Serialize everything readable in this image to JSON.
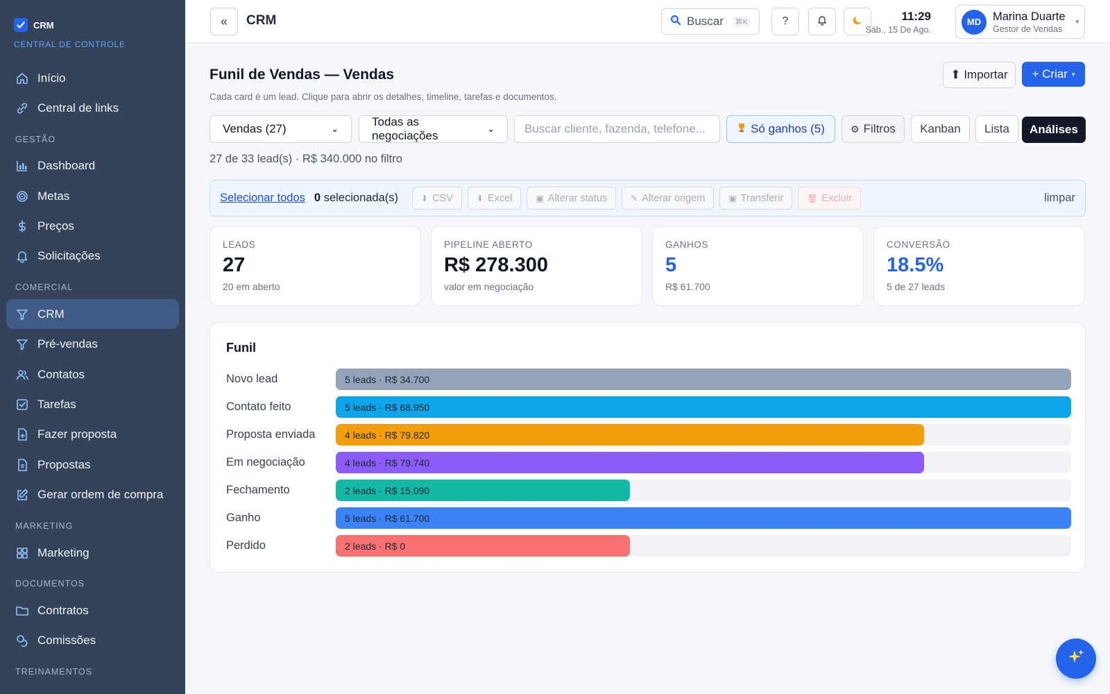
{
  "brand": {
    "name": "CRM",
    "subtitle": "CENTRAL DE CONTROLE"
  },
  "sidebar": {
    "top_items": [
      {
        "label": "Início",
        "icon": "home-icon"
      },
      {
        "label": "Central de links",
        "icon": "link-icon"
      }
    ],
    "sections": [
      {
        "title": "GESTÃO",
        "items": [
          {
            "label": "Dashboard",
            "icon": "bar-chart-icon"
          },
          {
            "label": "Metas",
            "icon": "target-icon"
          },
          {
            "label": "Preços",
            "icon": "dollar-icon"
          },
          {
            "label": "Solicitações",
            "icon": "bell-icon"
          }
        ]
      },
      {
        "title": "COMERCIAL",
        "items": [
          {
            "label": "CRM",
            "icon": "funnel-icon",
            "active": true
          },
          {
            "label": "Pré-vendas",
            "icon": "funnel-icon"
          },
          {
            "label": "Contatos",
            "icon": "users-icon"
          },
          {
            "label": "Tarefas",
            "icon": "checkbox-icon"
          },
          {
            "label": "Fazer proposta",
            "icon": "file-plus-icon"
          },
          {
            "label": "Propostas",
            "icon": "file-text-icon"
          },
          {
            "label": "Gerar ordem de compra",
            "icon": "edit-icon"
          }
        ]
      },
      {
        "title": "MARKETING",
        "items": [
          {
            "label": "Marketing",
            "icon": "grid-icon"
          }
        ]
      },
      {
        "title": "DOCUMENTOS",
        "items": [
          {
            "label": "Contratos",
            "icon": "folder-icon"
          },
          {
            "label": "Comissões",
            "icon": "coins-icon"
          }
        ]
      },
      {
        "title": "TREINAMENTOS",
        "items": []
      }
    ]
  },
  "header": {
    "collapse_label": "«",
    "title": "CRM",
    "search_label": "Buscar",
    "search_shortcut": "⌘K",
    "help_label": "?",
    "time": "11:29",
    "date": "Sáb., 15 De Ago.",
    "user": {
      "initials": "MD",
      "name": "Marina Duarte",
      "role": "Gestor de Vendas"
    }
  },
  "page": {
    "title": "Funil de Vendas — Vendas",
    "subtitle": "Cada card é um lead. Clique para abrir os detalhes, timeline, tarefas e documentos.",
    "import_label": "⬆ Importar",
    "create_label": "+ Criar",
    "pipeline_select": "Vendas (27)",
    "deals_select": "Todas as negociações",
    "search_placeholder": "Buscar cliente, fazenda, telefone...",
    "won_only_label": "Só ganhos (5)",
    "filters_label": "Filtros",
    "views": [
      "Kanban",
      "Lista",
      "Análises"
    ],
    "count_line": "27 de 33 lead(s) · R$ 340.000 no filtro"
  },
  "bulk": {
    "select_all": "Selecionar todos",
    "selected_count": "0",
    "selected_suffix": "selecionada(s)",
    "actions": [
      {
        "label": "CSV",
        "glyph": "⬇"
      },
      {
        "label": "Excel",
        "glyph": "⬇"
      },
      {
        "label": "Alterar status",
        "glyph": "▣"
      },
      {
        "label": "Alterar origem",
        "glyph": "✎"
      },
      {
        "label": "Transferir",
        "glyph": "▣"
      },
      {
        "label": "Excluir",
        "glyph": "🗑"
      }
    ],
    "clear_label": "limpar"
  },
  "kpis": [
    {
      "label": "LEADS",
      "value": "27",
      "sub": "20 em aberto",
      "blue": false
    },
    {
      "label": "PIPELINE ABERTO",
      "value": "R$ 278.300",
      "sub": "valor em negociação",
      "blue": false
    },
    {
      "label": "GANHOS",
      "value": "5",
      "sub": "R$ 61.700",
      "blue": true
    },
    {
      "label": "CONVERSÃO",
      "value": "18.5%",
      "sub": "5 de 27 leads",
      "blue": true
    }
  ],
  "funnel": {
    "title": "Funil",
    "max_leads": 5,
    "stages": [
      {
        "label": "Novo lead",
        "leads": 5,
        "text": "5 leads · R$ 34.700",
        "color": "#94a3b8"
      },
      {
        "label": "Contato feito",
        "leads": 5,
        "text": "5 leads · R$ 68.950",
        "color": "#0ea5e9"
      },
      {
        "label": "Proposta enviada",
        "leads": 4,
        "text": "4 leads · R$ 79.820",
        "color": "#f59e0b"
      },
      {
        "label": "Em negociação",
        "leads": 4,
        "text": "4 leads · R$ 79.740",
        "color": "#8b5cf6"
      },
      {
        "label": "Fechamento",
        "leads": 2,
        "text": "2 leads · R$ 15.090",
        "color": "#14b8a6"
      },
      {
        "label": "Ganho",
        "leads": 5,
        "text": "5 leads · R$ 61.700",
        "color": "#3b82f6"
      },
      {
        "label": "Perdido",
        "leads": 2,
        "text": "2 leads · R$ 0",
        "color": "#f87171"
      }
    ]
  },
  "colors": {
    "accent": "#2563eb",
    "sidebar": "#34425a",
    "sidebar_active": "#3f5b86"
  }
}
